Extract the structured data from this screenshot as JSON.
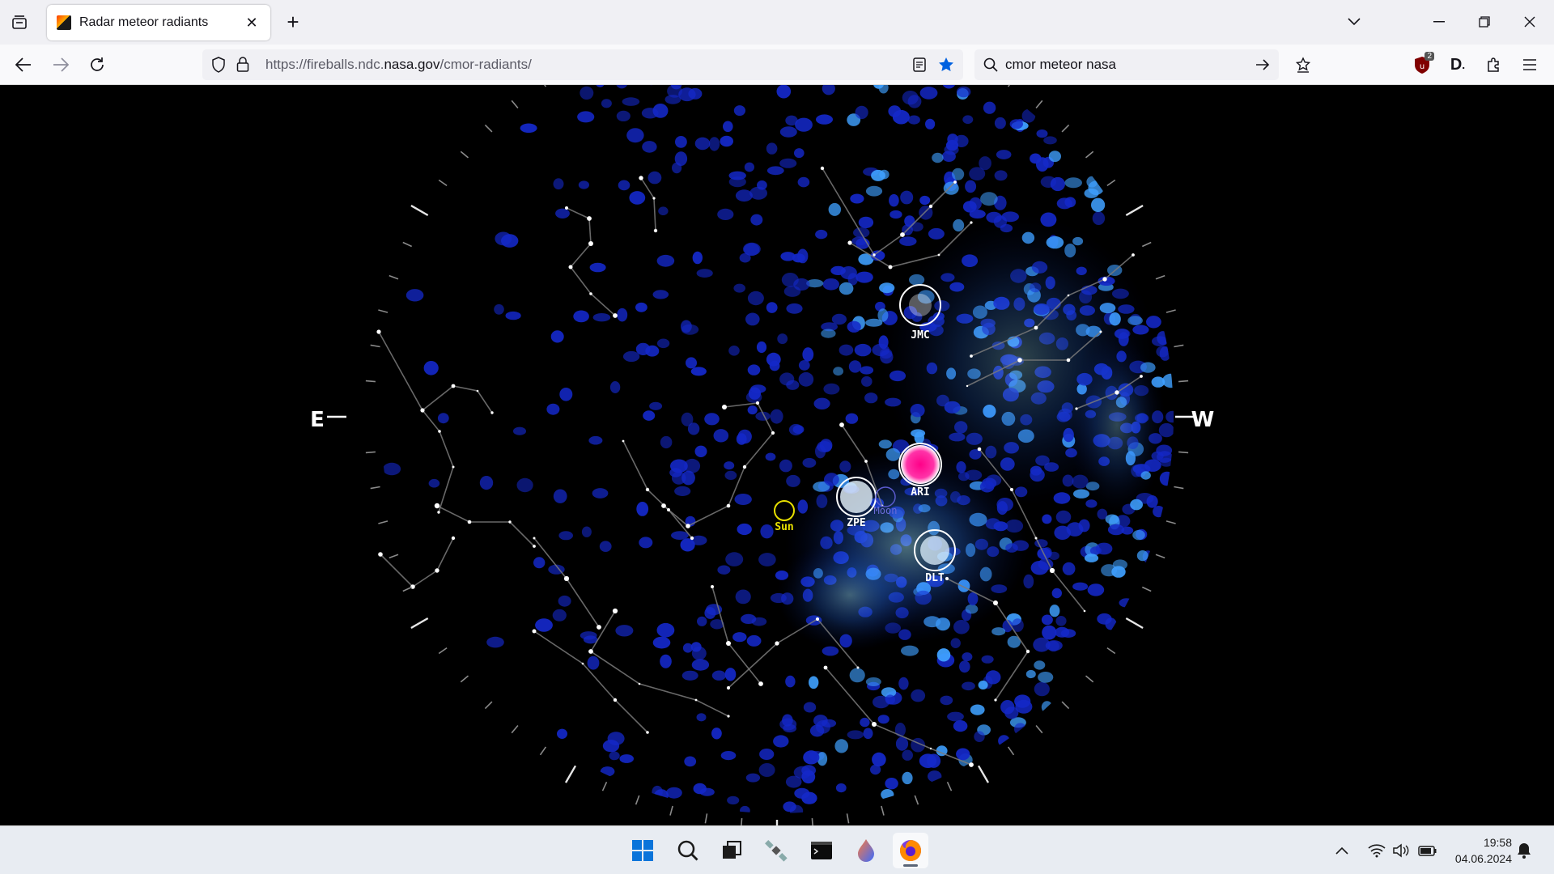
{
  "browser": {
    "tab": {
      "title": "Radar meteor radiants"
    },
    "url": {
      "prefix": "https://fireballs.ndc.",
      "host": "nasa.gov",
      "path": "/cmor-radiants/"
    },
    "search": {
      "value": "cmor meteor nasa"
    },
    "ublock_badge": "2"
  },
  "skymap": {
    "compass": {
      "east": "E",
      "west": "W"
    },
    "showers": [
      {
        "code": "JMC"
      },
      {
        "code": "ARI"
      },
      {
        "code": "ZPE"
      },
      {
        "code": "DLT"
      }
    ],
    "sun_label": "Sun",
    "moon_label": "Moon",
    "colors": {
      "sun": "#e8e000",
      "moon": "#6666dd",
      "ari_peak": "#ff0090",
      "dots": "#1428c8",
      "lines": "#7a7a7a"
    }
  },
  "taskbar": {
    "apps": [
      "windows-start",
      "search",
      "task-view",
      "satellite-app",
      "terminal",
      "app-drop",
      "firefox"
    ],
    "clock": {
      "time": "19:58",
      "date": "04.06.2024"
    }
  }
}
